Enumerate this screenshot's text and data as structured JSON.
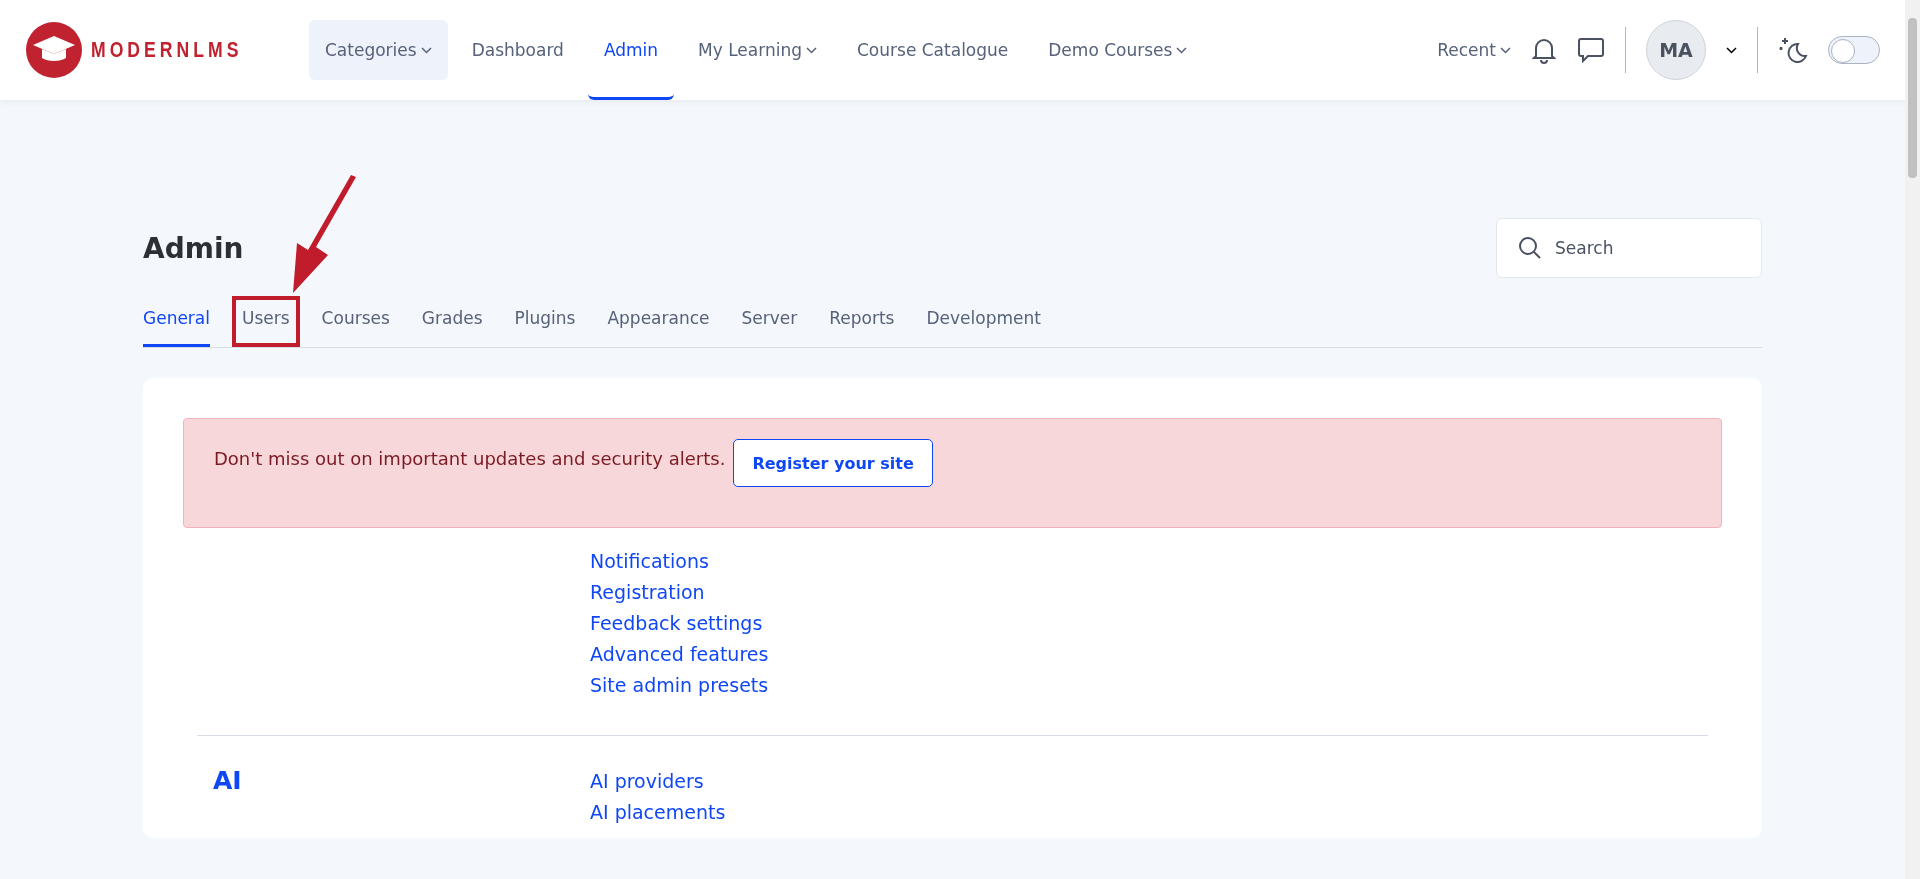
{
  "header": {
    "logo": {
      "wordmark": "MODERNLMS"
    },
    "nav": [
      {
        "label": "Categories",
        "dropdown": true,
        "kind": "pill",
        "selected": false
      },
      {
        "label": "Dashboard",
        "dropdown": false,
        "kind": "link",
        "selected": false
      },
      {
        "label": "Admin",
        "dropdown": false,
        "kind": "link",
        "selected": true
      },
      {
        "label": "My Learning",
        "dropdown": true,
        "kind": "link",
        "selected": false
      },
      {
        "label": "Course Catalogue",
        "dropdown": false,
        "kind": "link",
        "selected": false
      },
      {
        "label": "Demo Courses",
        "dropdown": true,
        "kind": "link",
        "selected": false
      }
    ],
    "recent": "Recent",
    "avatar": "MA",
    "dark_mode": {
      "on": false
    }
  },
  "page": {
    "title": "Admin",
    "search": {
      "placeholder": "Search"
    },
    "tabs": [
      {
        "label": "General",
        "selected": true,
        "highlighted": false
      },
      {
        "label": "Users",
        "selected": false,
        "highlighted": true
      },
      {
        "label": "Courses",
        "selected": false,
        "highlighted": false
      },
      {
        "label": "Grades",
        "selected": false,
        "highlighted": false
      },
      {
        "label": "Plugins",
        "selected": false,
        "highlighted": false
      },
      {
        "label": "Appearance",
        "selected": false,
        "highlighted": false
      },
      {
        "label": "Server",
        "selected": false,
        "highlighted": false
      },
      {
        "label": "Reports",
        "selected": false,
        "highlighted": false
      },
      {
        "label": "Development",
        "selected": false,
        "highlighted": false
      }
    ],
    "alert": {
      "message": "Don't miss out on important updates and security alerts.",
      "button": "Register your site"
    },
    "sections": [
      {
        "links": [
          "Notifications",
          "Registration",
          "Feedback settings",
          "Advanced features",
          "Site admin presets"
        ]
      },
      {
        "heading": "AI",
        "links": [
          "AI providers",
          "AI placements"
        ]
      }
    ]
  }
}
